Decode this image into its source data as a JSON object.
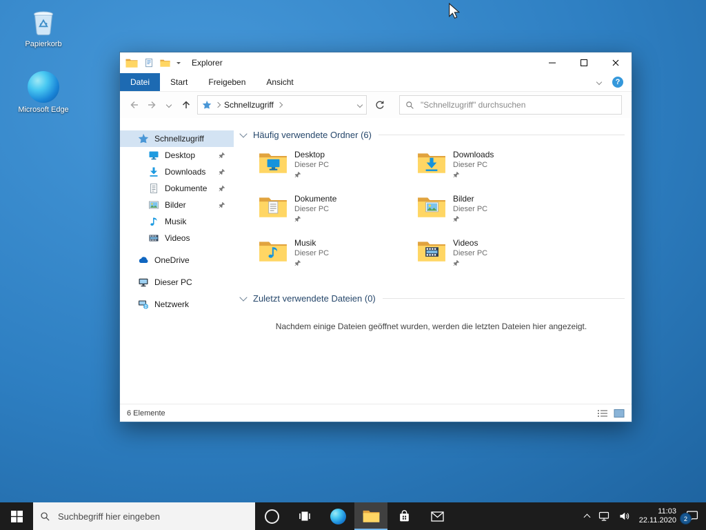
{
  "colors": {
    "accent": "#0078d7",
    "file_tab_blue": "#1d6ab2",
    "taskbar_bg": "#1c1c1c",
    "desktop_blue": "#2e7fc2",
    "selected_nav": "#d3e3f3"
  },
  "icons": {
    "help_glyph": "?"
  },
  "desktop": {
    "icons": [
      {
        "label": "Papierkorb"
      },
      {
        "label": "Microsoft Edge"
      }
    ]
  },
  "window": {
    "title": "Explorer",
    "tabs": [
      {
        "label": "Datei"
      },
      {
        "label": "Start"
      },
      {
        "label": "Freigeben"
      },
      {
        "label": "Ansicht"
      }
    ],
    "address": {
      "location": "Schnellzugriff"
    },
    "search": {
      "placeholder": "\"Schnellzugriff\" durchsuchen"
    },
    "sidebar": {
      "items": [
        {
          "label": "Schnellzugriff"
        },
        {
          "label": "Desktop"
        },
        {
          "label": "Downloads"
        },
        {
          "label": "Dokumente"
        },
        {
          "label": "Bilder"
        },
        {
          "label": "Musik"
        },
        {
          "label": "Videos"
        },
        {
          "label": "OneDrive"
        },
        {
          "label": "Dieser PC"
        },
        {
          "label": "Netzwerk"
        }
      ]
    },
    "sections": [
      {
        "title": "Häufig verwendete Ordner (6)"
      },
      {
        "title": "Zuletzt verwendete Dateien (0)",
        "empty_message": "Nachdem einige Dateien geöffnet wurden, werden die letzten Dateien hier angezeigt."
      }
    ],
    "folders": [
      {
        "name": "Desktop",
        "location": "Dieser PC"
      },
      {
        "name": "Downloads",
        "location": "Dieser PC"
      },
      {
        "name": "Dokumente",
        "location": "Dieser PC"
      },
      {
        "name": "Bilder",
        "location": "Dieser PC"
      },
      {
        "name": "Musik",
        "location": "Dieser PC"
      },
      {
        "name": "Videos",
        "location": "Dieser PC"
      }
    ],
    "status": {
      "text": "6 Elemente"
    }
  },
  "taskbar": {
    "search_placeholder": "Suchbegriff hier eingeben",
    "clock": {
      "time": "11:03",
      "date": "22.11.2020"
    },
    "notifications": {
      "badge": "2"
    }
  }
}
